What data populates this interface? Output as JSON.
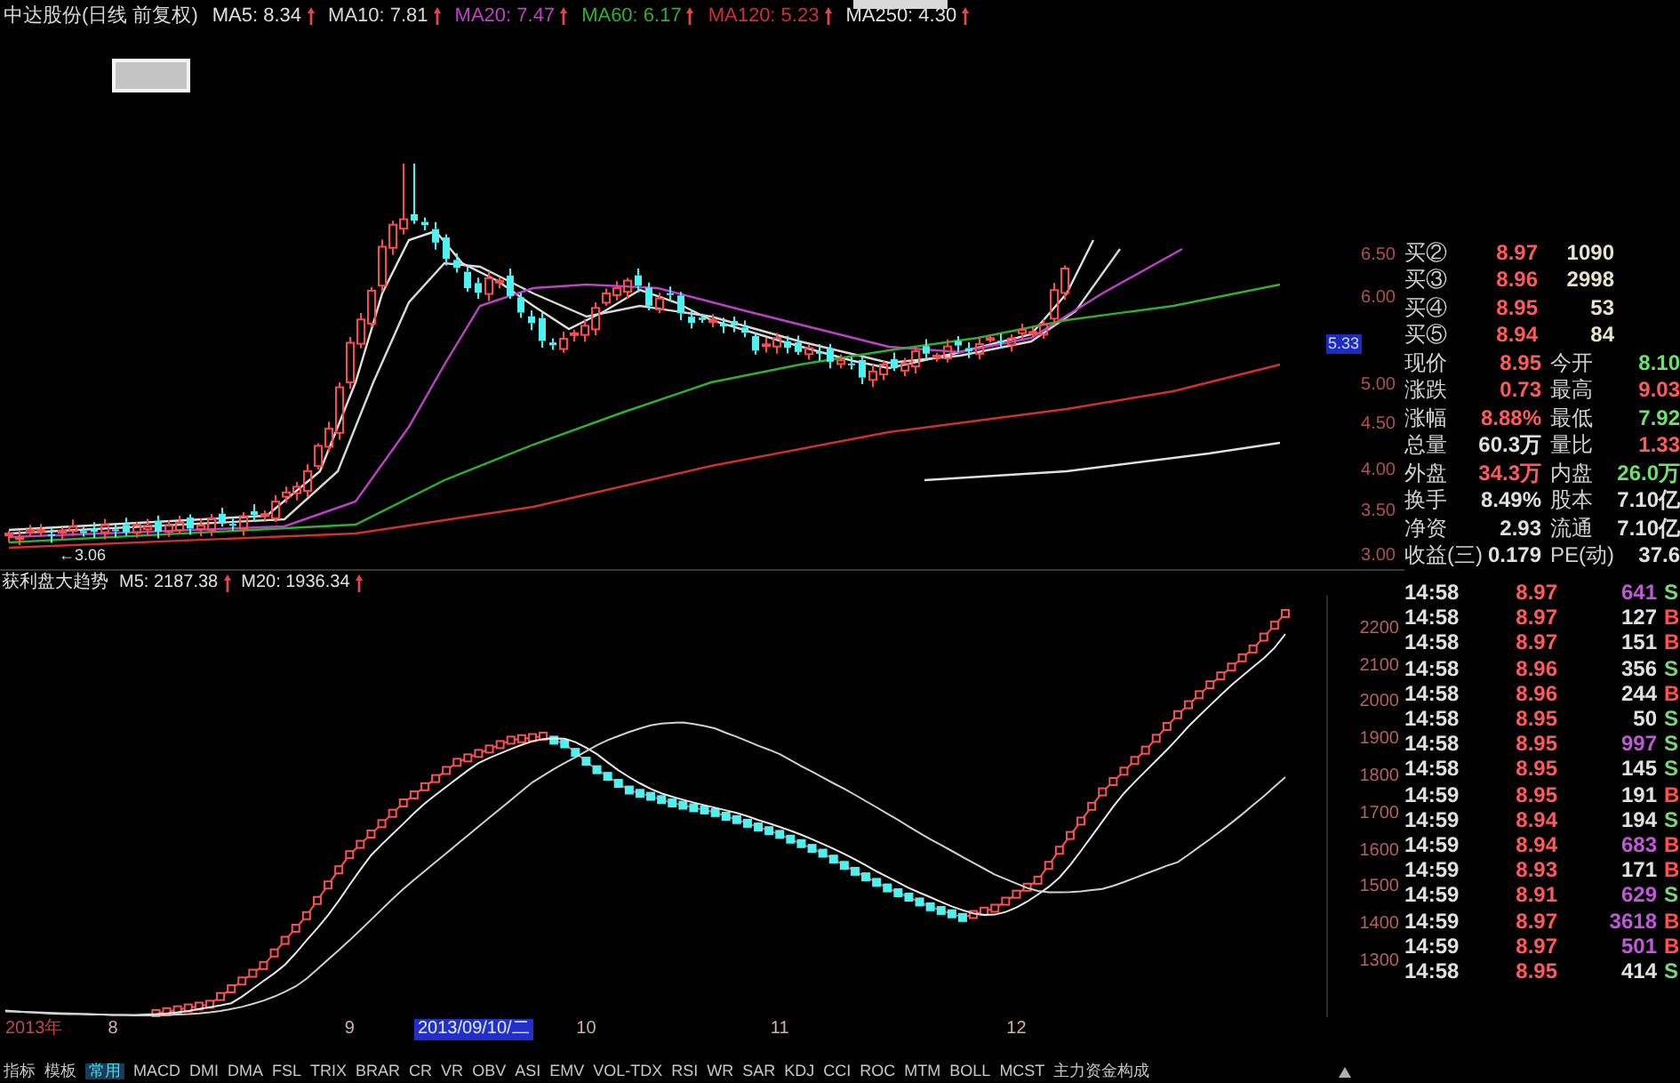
{
  "header": {
    "title": "中达股份(日线 前复权)",
    "averages": [
      {
        "label": "MA5: 8.34",
        "color": "#e0e0e0",
        "rising": true
      },
      {
        "label": "MA10: 7.81",
        "color": "#d8d8d8",
        "rising": true
      },
      {
        "label": "MA20: 7.47",
        "color": "#c040c8",
        "rising": true
      },
      {
        "label": "MA60: 6.17",
        "color": "#30b030",
        "rising": true
      },
      {
        "label": "MA120: 5.23",
        "color": "#d03030",
        "rising": true
      },
      {
        "label": "MA250: 4.30",
        "color": "#e0e0e0",
        "rising": true
      }
    ]
  },
  "price_chart": {
    "low_marker": "←3.06",
    "axis_labels": [
      "6.50",
      "6.00",
      "5.00",
      "4.50",
      "4.00",
      "3.50",
      "3.00"
    ],
    "current_price_tag": "5.33"
  },
  "indicator_panel": {
    "legend": [
      {
        "label": "M5: 2187.38",
        "rising": true
      },
      {
        "label": "M20: 1936.34",
        "rising": true
      }
    ],
    "year_label": "2013年",
    "cursor_date": "2013/09/10/二",
    "chart_data": {
      "type": "line",
      "title": "获利盘大趋势",
      "categories": [
        null,
        null,
        null,
        null,
        null,
        null,
        null,
        null,
        null,
        null,
        "8",
        null,
        null,
        null,
        null,
        null,
        null,
        null,
        null,
        null,
        null,
        null,
        null,
        null,
        null,
        null,
        null,
        null,
        null,
        null,
        null,
        null,
        "9",
        null,
        null,
        null,
        null,
        null,
        null,
        null,
        null,
        null,
        null,
        null,
        null,
        null,
        null,
        null,
        null,
        null,
        null,
        null,
        null,
        null,
        "10",
        null,
        null,
        null,
        null,
        null,
        null,
        null,
        null,
        null,
        null,
        null,
        null,
        null,
        null,
        null,
        null,
        null,
        "11",
        null,
        null,
        null,
        null,
        null,
        null,
        null,
        null,
        null,
        null,
        null,
        null,
        null,
        null,
        null,
        null,
        null,
        null,
        null,
        null,
        null,
        "12",
        null,
        null,
        null,
        null,
        null,
        null,
        null,
        null,
        null,
        null,
        null,
        null,
        null,
        null,
        null,
        null,
        null,
        null,
        null,
        null,
        null,
        null,
        null,
        null,
        null
      ],
      "ylim": [
        1150,
        2291
      ],
      "yticks": [
        1300,
        1400,
        1500,
        1600,
        1700,
        1800,
        1900,
        2000,
        2100,
        2200
      ],
      "series": [
        {
          "color": "#ff5050",
          "marker": "square",
          "values": [
            null,
            null,
            null,
            null,
            null,
            null,
            null,
            null,
            null,
            null,
            null,
            null,
            null,
            null,
            1160,
            1165,
            1170,
            1175,
            1180,
            1185,
            1206,
            1227,
            1248,
            1269,
            1290,
            1324,
            1358,
            1391,
            1425,
            1466,
            1508,
            1549,
            1590,
            1618,
            1646,
            1674,
            1702,
            1730,
            1752,
            1774,
            1796,
            1818,
            1840,
            1852,
            1864,
            1876,
            1888,
            1900,
            1904,
            1907,
            1911,
            1900,
            1890,
            1867,
            1843,
            1820,
            1802,
            1783,
            1765,
            1756,
            1748,
            1739,
            1730,
            1724,
            1717,
            1711,
            1704,
            1694,
            1685,
            1675,
            1665,
            1655,
            1645,
            1632,
            1620,
            1607,
            1594,
            1578,
            1561,
            1545,
            1530,
            1515,
            1500,
            1487,
            1475,
            1462,
            1449,
            1439,
            1430,
            1420,
            1428,
            1437,
            1445,
            1464,
            1483,
            1502,
            1521,
            1561,
            1602,
            1642,
            1681,
            1721,
            1760,
            1788,
            1816,
            1845,
            1873,
            1905,
            1937,
            1969,
            1996,
            2023,
            2050,
            2074,
            2098,
            2123,
            2147,
            2179,
            2211,
            2243
          ]
        },
        {
          "color": "#e8e8e8",
          "values": [
            1168,
            1166,
            1164,
            1162,
            1160,
            1159,
            1158,
            1158,
            1157,
            1157,
            1156,
            1156,
            1156,
            1157,
            1158,
            1160,
            1163,
            1167,
            1172,
            1177,
            1182,
            1188,
            1206,
            1227,
            1248,
            1269,
            1292,
            1324,
            1358,
            1391,
            1426,
            1466,
            1508,
            1549,
            1588,
            1618,
            1646,
            1674,
            1702,
            1729,
            1752,
            1774,
            1796,
            1818,
            1838,
            1852,
            1864,
            1876,
            1887,
            1897,
            1903,
            1905,
            1904,
            1895,
            1880,
            1862,
            1840,
            1818,
            1800,
            1783,
            1768,
            1756,
            1747,
            1739,
            1731,
            1724,
            1717,
            1710,
            1703,
            1694,
            1684,
            1675,
            1665,
            1655,
            1644,
            1632,
            1619,
            1606,
            1592,
            1577,
            1561,
            1545,
            1530,
            1515,
            1500,
            1487,
            1475,
            1462,
            1450,
            1440,
            1431,
            1427,
            1428,
            1435,
            1447,
            1463,
            1482,
            1503,
            1528,
            1562,
            1600,
            1640,
            1680,
            1720,
            1756,
            1787,
            1816,
            1845,
            1874,
            1905,
            1937,
            1966,
            1994,
            2022,
            2049,
            2074,
            2098,
            2122,
            2150,
            2187
          ]
        },
        {
          "color": "#d0d0d0",
          "values": [
            1166,
            1165,
            1164,
            1163,
            1162,
            1161,
            1160,
            1159,
            1158,
            1157,
            1156,
            1156,
            1155,
            1155,
            1155,
            1156,
            1157,
            1158,
            1160,
            1163,
            1167,
            1172,
            1178,
            1186,
            1195,
            1206,
            1219,
            1234,
            1254,
            1280,
            1306,
            1332,
            1358,
            1386,
            1414,
            1442,
            1470,
            1497,
            1522,
            1546,
            1570,
            1594,
            1618,
            1642,
            1666,
            1690,
            1714,
            1738,
            1762,
            1786,
            1804,
            1822,
            1838,
            1854,
            1870,
            1886,
            1900,
            1911,
            1922,
            1932,
            1940,
            1945,
            1947,
            1948,
            1944,
            1938,
            1932,
            1920,
            1909,
            1897,
            1885,
            1874,
            1862,
            1846,
            1830,
            1815,
            1799,
            1783,
            1768,
            1752,
            1735,
            1718,
            1701,
            1684,
            1666,
            1649,
            1632,
            1616,
            1600,
            1584,
            1568,
            1552,
            1536,
            1524,
            1512,
            1500,
            1492,
            1488,
            1488,
            1489,
            1491,
            1494,
            1497,
            1506,
            1516,
            1527,
            1538,
            1549,
            1560,
            1570,
            1590,
            1611,
            1632,
            1654,
            1676,
            1700,
            1724,
            1748,
            1774,
            1800
          ]
        }
      ]
    }
  },
  "order_book": [
    {
      "label": "买②",
      "price": "8.97",
      "volume": "1090"
    },
    {
      "label": "买③",
      "price": "8.96",
      "volume": "2998"
    },
    {
      "label": "买④",
      "price": "8.95",
      "volume": "53"
    },
    {
      "label": "买⑤",
      "price": "8.94",
      "volume": "84"
    }
  ],
  "quote": [
    {
      "label": "现价",
      "value": "8.95",
      "color": "#ff5a5a"
    },
    {
      "label": "今开",
      "value": "8.10",
      "color": "#6ee06e"
    },
    {
      "label": "涨跌",
      "value": "0.73",
      "color": "#ff5a5a"
    },
    {
      "label": "最高",
      "value": "9.03",
      "color": "#ff5a5a"
    },
    {
      "label": "涨幅",
      "value": "8.88%",
      "color": "#ff5a5a"
    },
    {
      "label": "最低",
      "value": "7.92",
      "color": "#6ee06e"
    },
    {
      "label": "总量",
      "value": "60.3万",
      "color": "#e0e0e0"
    },
    {
      "label": "量比",
      "value": "1.33",
      "color": "#ff5a5a"
    },
    {
      "label": "外盘",
      "value": "34.3万",
      "color": "#ff5a5a"
    },
    {
      "label": "内盘",
      "value": "26.0万",
      "color": "#6ee06e"
    },
    {
      "label": "换手",
      "value": "8.49%",
      "color": "#e0e0e0"
    },
    {
      "label": "股本",
      "value": "7.10亿",
      "color": "#e0e0e0"
    },
    {
      "label": "净资",
      "value": "2.93",
      "color": "#e0e0e0"
    },
    {
      "label": "流通",
      "value": "7.10亿",
      "color": "#e0e0e0"
    },
    {
      "label": "收益(三)",
      "value": "0.179",
      "color": "#e0e0e0"
    },
    {
      "label": "PE(动)",
      "value": "37.6",
      "color": "#e0e0e0"
    }
  ],
  "ticks": [
    {
      "time": "14:58",
      "price": "8.97",
      "volume": "641",
      "large": true,
      "side": "S",
      "buy": false
    },
    {
      "time": "14:58",
      "price": "8.97",
      "volume": "127",
      "large": false,
      "side": "B",
      "buy": true
    },
    {
      "time": "14:58",
      "price": "8.97",
      "volume": "151",
      "large": false,
      "side": "B",
      "buy": true
    },
    {
      "time": "14:58",
      "price": "8.96",
      "volume": "356",
      "large": false,
      "side": "S",
      "buy": false
    },
    {
      "time": "14:58",
      "price": "8.96",
      "volume": "244",
      "large": false,
      "side": "B",
      "buy": true
    },
    {
      "time": "14:58",
      "price": "8.95",
      "volume": "50",
      "large": false,
      "side": "S",
      "buy": false
    },
    {
      "time": "14:58",
      "price": "8.95",
      "volume": "997",
      "large": true,
      "side": "S",
      "buy": false
    },
    {
      "time": "14:58",
      "price": "8.95",
      "volume": "145",
      "large": false,
      "side": "S",
      "buy": false
    },
    {
      "time": "14:59",
      "price": "8.95",
      "volume": "191",
      "large": false,
      "side": "B",
      "buy": true
    },
    {
      "time": "14:59",
      "price": "8.94",
      "volume": "194",
      "large": false,
      "side": "S",
      "buy": false
    },
    {
      "time": "14:59",
      "price": "8.94",
      "volume": "683",
      "large": true,
      "side": "B",
      "buy": true
    },
    {
      "time": "14:59",
      "price": "8.93",
      "volume": "171",
      "large": false,
      "side": "B",
      "buy": true
    },
    {
      "time": "14:59",
      "price": "8.91",
      "volume": "629",
      "large": true,
      "side": "S",
      "buy": false
    },
    {
      "time": "14:59",
      "price": "8.97",
      "volume": "3618",
      "large": true,
      "side": "B",
      "buy": true
    },
    {
      "time": "14:59",
      "price": "8.97",
      "volume": "501",
      "large": true,
      "side": "B",
      "buy": true
    },
    {
      "time": "14:58",
      "price": "8.95",
      "volume": "414",
      "large": false,
      "side": "S",
      "buy": false
    }
  ],
  "indicator_tabs": [
    {
      "label": "指标",
      "selected": false
    },
    {
      "label": "模板",
      "selected": false
    },
    {
      "label": "常用",
      "selected": true
    },
    {
      "label": "MACD",
      "selected": false
    },
    {
      "label": "DMI",
      "selected": false
    },
    {
      "label": "DMA",
      "selected": false
    },
    {
      "label": "FSL",
      "selected": false
    },
    {
      "label": "TRIX",
      "selected": false
    },
    {
      "label": "BRAR",
      "selected": false
    },
    {
      "label": "CR",
      "selected": false
    },
    {
      "label": "VR",
      "selected": false
    },
    {
      "label": "OBV",
      "selected": false
    },
    {
      "label": "ASI",
      "selected": false
    },
    {
      "label": "EMV",
      "selected": false
    },
    {
      "label": "VOL-TDX",
      "selected": false
    },
    {
      "label": "RSI",
      "selected": false
    },
    {
      "label": "WR",
      "selected": false
    },
    {
      "label": "SAR",
      "selected": false
    },
    {
      "label": "KDJ",
      "selected": false
    },
    {
      "label": "CCI",
      "selected": false
    },
    {
      "label": "ROC",
      "selected": false
    },
    {
      "label": "MTM",
      "selected": false
    },
    {
      "label": "BOLL",
      "selected": false
    },
    {
      "label": "MCST",
      "selected": false
    },
    {
      "label": "主力资金构成",
      "selected": false
    }
  ]
}
